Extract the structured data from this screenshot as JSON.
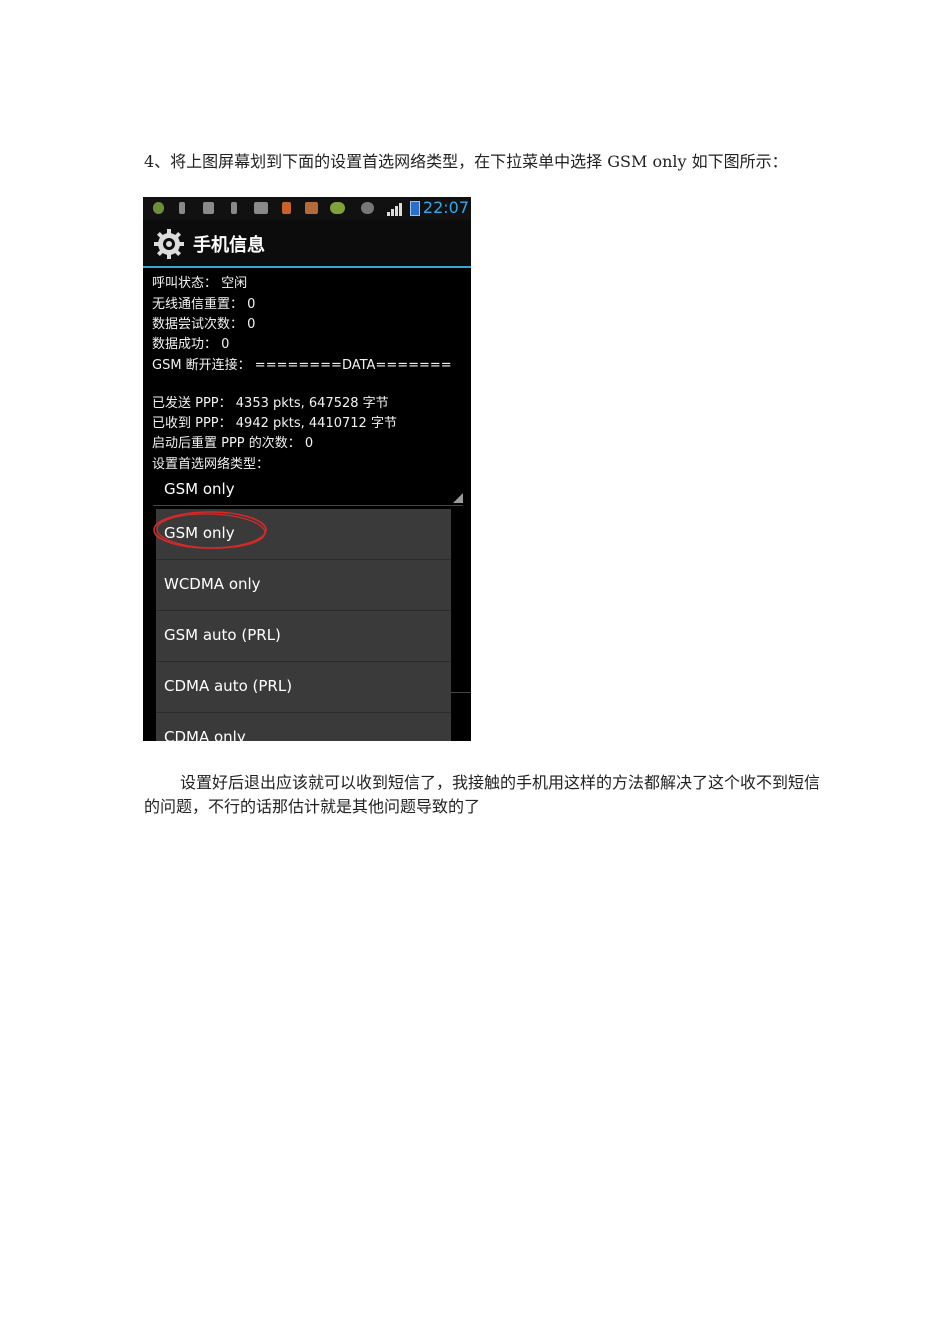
{
  "intro_text": "4、将上图屏幕划到下面的设置首选网络类型，在下拉菜单中选择 GSM only 如下图所示：",
  "outro_text": "设置好后退出应该就可以收到短信了，我接触的手机用这样的方法都解决了这个收不到短信的问题，不行的话那估计就是其他问题导致的了",
  "phone": {
    "status_time": "22:07",
    "app_title": "手机信息",
    "info_lines": [
      "呼叫状态： 空闲",
      "无线通信重置： 0",
      "数据尝试次数： 0",
      "数据成功： 0",
      "GSM 断开连接： ========DATA=======",
      "已发送 PPP： 4353 pkts, 647528 字节",
      "已收到 PPP： 4942 pkts, 4410712 字节",
      "启动后重置 PPP 的次数： 0",
      "设置首选网络类型："
    ],
    "spinner_value": "GSM only",
    "options": [
      "GSM only",
      "WCDMA only",
      "GSM auto (PRL)",
      "CDMA auto (PRL)",
      "CDMA only"
    ],
    "highlight_color": "#d42a2a",
    "accent_color": "#33a5d8"
  }
}
